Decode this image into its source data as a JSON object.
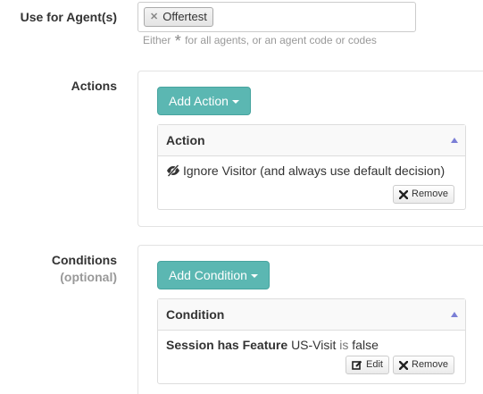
{
  "agents": {
    "label": "Use for Agent(s)",
    "token": "Offertest",
    "help_before": "Either",
    "help_star": "*",
    "help_after": "for all agents, or an agent code or codes"
  },
  "actions": {
    "label": "Actions",
    "add_button": "Add Action",
    "column_header": "Action",
    "row_text": "Ignore Visitor (and always use default decision)",
    "row_icon": "eye-slash-icon",
    "remove_button": "Remove"
  },
  "conditions": {
    "label": "Conditions",
    "sublabel": "(optional)",
    "add_button": "Add Condition",
    "column_header": "Condition",
    "row_bold": "Session has Feature",
    "row_feature": "US-Visit",
    "row_op": "is",
    "row_value": "false",
    "edit_button": "Edit",
    "remove_button": "Remove"
  },
  "colors": {
    "primary_button": "#5bb7b2",
    "sort_arrow": "#7b7fd6",
    "muted_text": "#999999"
  }
}
